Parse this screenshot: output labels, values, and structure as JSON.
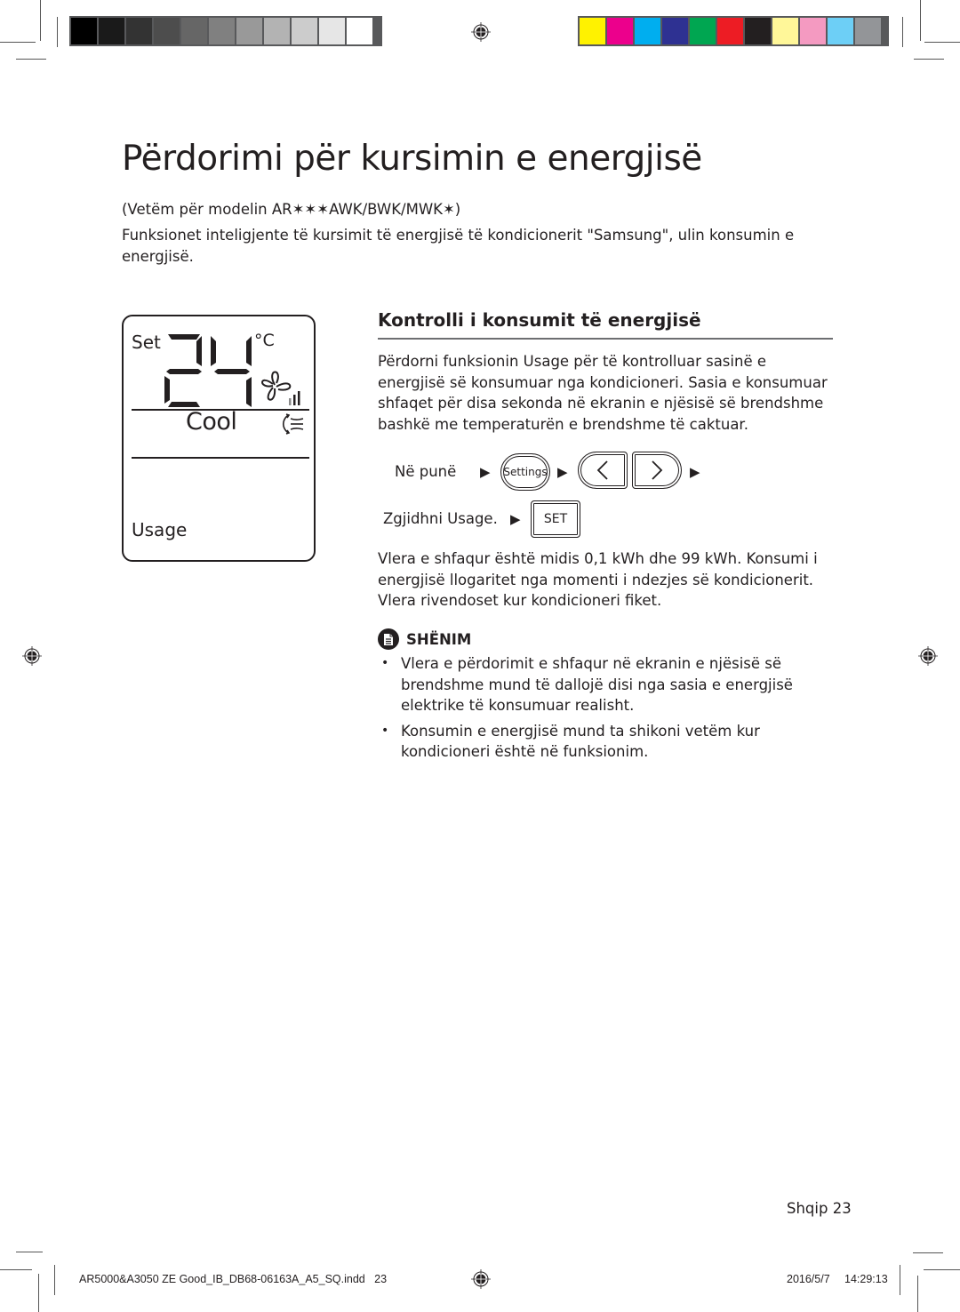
{
  "print_marks": {
    "grayscale_swatches": [
      "#000000",
      "#1a1a1a",
      "#333333",
      "#4d4d4d",
      "#666666",
      "#808080",
      "#999999",
      "#b3b3b3",
      "#cccccc",
      "#e6e6e6",
      "#ffffff"
    ],
    "color_swatches": [
      "#fff200",
      "#ec008c",
      "#00aeef",
      "#2e3192",
      "#00a651",
      "#ed1c24",
      "#231f20",
      "#fff799",
      "#f49ac1",
      "#6dcff6",
      "#939598"
    ],
    "registration_mark_icon": "crosshair-registration-icon"
  },
  "page": {
    "title": "Përdorimi për kursimin e energjisë",
    "model_note": "(Vetëm për modelin AR✶✶✶AWK/BWK/MWK✶)",
    "intro": "Funksionet inteligjente të kursimit të energjisë të kondicionerit \"Samsung\", ulin konsumin e energjisë."
  },
  "lcd": {
    "set_label": "Set",
    "temperature": "24",
    "unit": "°C",
    "fan_icon": "fan-icon",
    "fan_speed_bars": 3,
    "mode": "Cool",
    "swing_icon": "airflow-swing-icon",
    "function": "Usage"
  },
  "section": {
    "title": "Kontrolli i konsumit të energjisë",
    "description": "Përdorni funksionin Usage për të kontrolluar sasinë e energjisë së konsumuar nga kondicioneri. Sasia e konsumuar shfaqet për disa sekonda në ekranin e njësisë së brendshme bashkë me temperaturën e brendshme të caktuar.",
    "steps": {
      "step1_label": "Në punë",
      "settings_button": "Settings",
      "left_button_icon": "chevron-left-icon",
      "right_button_icon": "chevron-right-icon",
      "step2_label": "Zgjidhni Usage.",
      "set_button": "SET",
      "arrow": "▶"
    },
    "range_text": "Vlera e shfaqur është midis 0,1 kWh dhe 99 kWh. Konsumi i energjisë llogaritet nga momenti i ndezjes së kondicionerit. Vlera rivendoset kur kondicioneri fiket."
  },
  "note": {
    "icon": "note-document-icon",
    "title": "SHËNIM",
    "items": [
      "Vlera e përdorimit e shfaqur në ekranin e njësisë së brendshme mund të dallojë disi nga sasia e energjisë elektrike të konsumuar realisht.",
      "Konsumin e energjisë mund ta shikoni vetëm kur kondicioneri është në funksionim."
    ]
  },
  "footer": {
    "language": "Shqip",
    "page_number": "23",
    "slug_file": "AR5000&A3050 ZE Good_IB_DB68-06163A_A5_SQ.indd   23",
    "slug_date": "2016/5/7",
    "slug_time": "14:29:13"
  }
}
